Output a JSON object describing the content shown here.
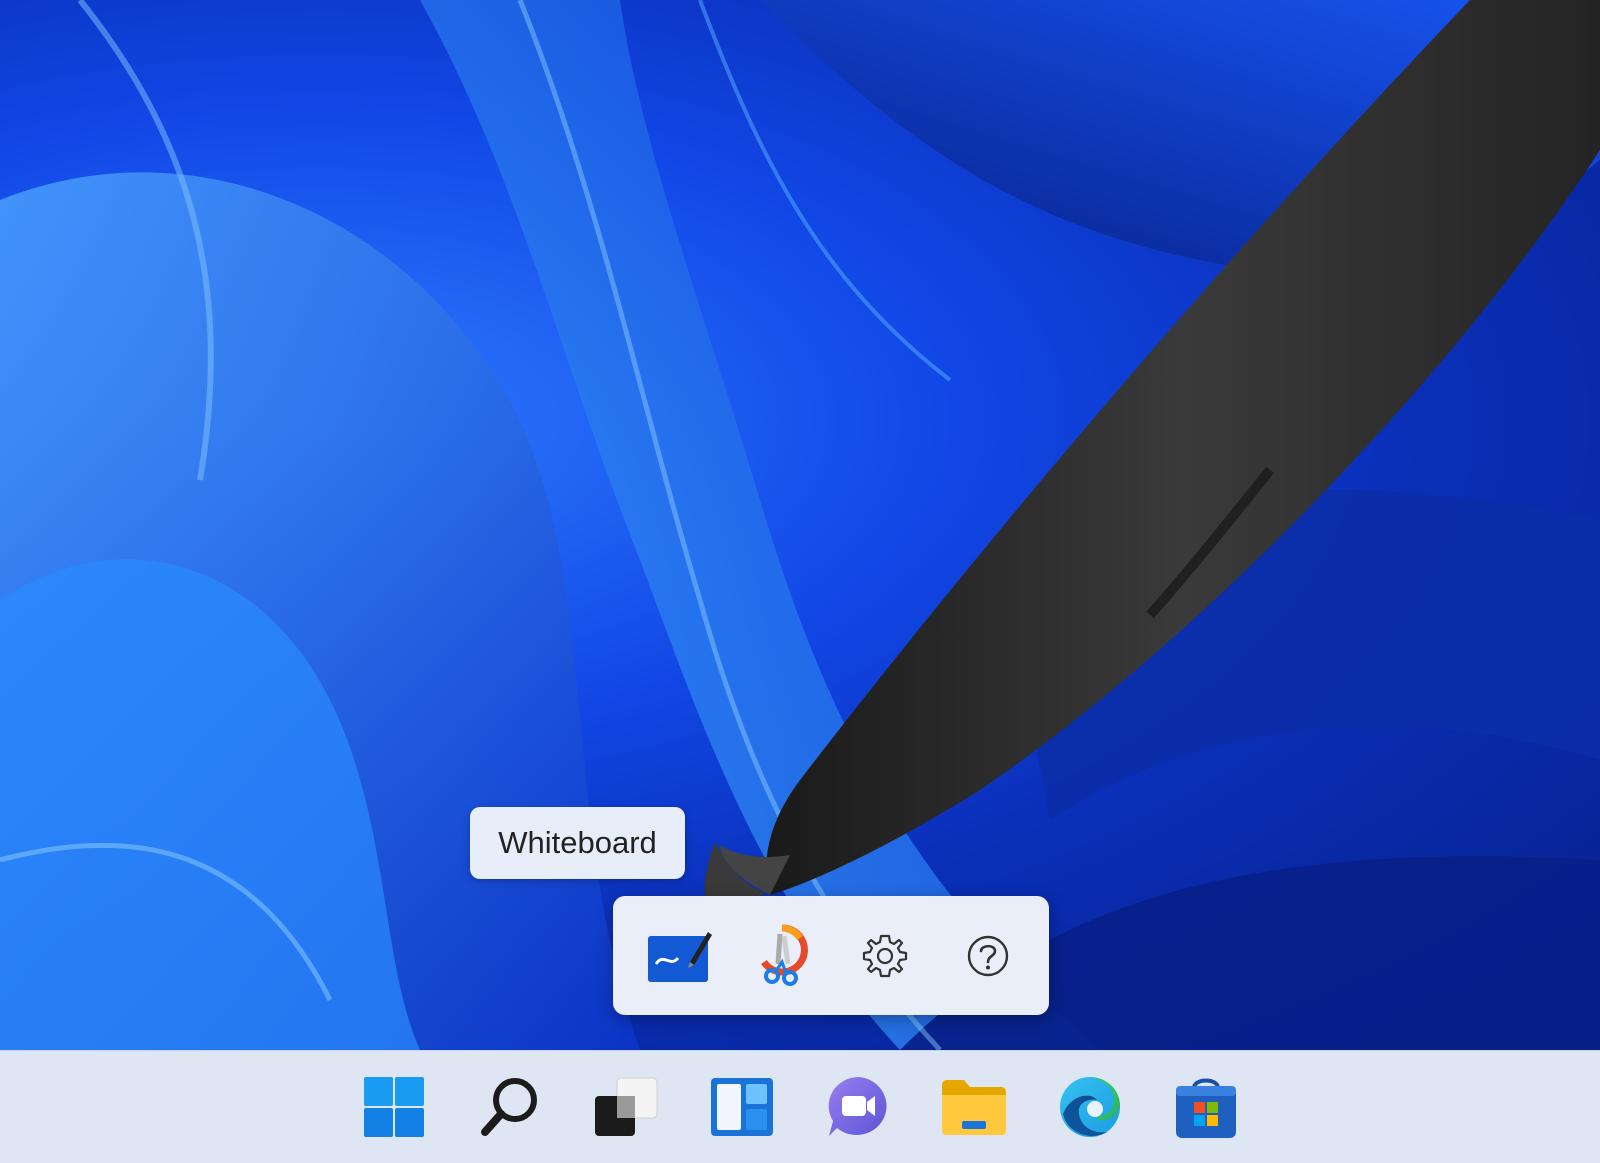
{
  "tooltip": {
    "text": "Whiteboard"
  },
  "pen_menu": {
    "items": [
      {
        "name": "whiteboard",
        "icon": "whiteboard-icon"
      },
      {
        "name": "snipping-tool",
        "icon": "snipping-tool-icon"
      },
      {
        "name": "pen-settings",
        "icon": "gear-icon"
      },
      {
        "name": "help",
        "icon": "question-icon"
      }
    ]
  },
  "taskbar": {
    "items": [
      {
        "name": "start",
        "icon": "windows-logo-icon"
      },
      {
        "name": "search",
        "icon": "search-icon"
      },
      {
        "name": "task-view",
        "icon": "task-view-icon"
      },
      {
        "name": "widgets",
        "icon": "widgets-icon"
      },
      {
        "name": "teams-chat",
        "icon": "chat-icon"
      },
      {
        "name": "file-explorer",
        "icon": "folder-icon"
      },
      {
        "name": "edge",
        "icon": "edge-icon"
      },
      {
        "name": "microsoft-store",
        "icon": "store-icon"
      }
    ]
  },
  "colors": {
    "wallpaper_blue": "#1147e6",
    "menu_bg": "#e9eef8",
    "taskbar_bg": "#dfe6f3",
    "pen_body": "#2b2b2b"
  }
}
